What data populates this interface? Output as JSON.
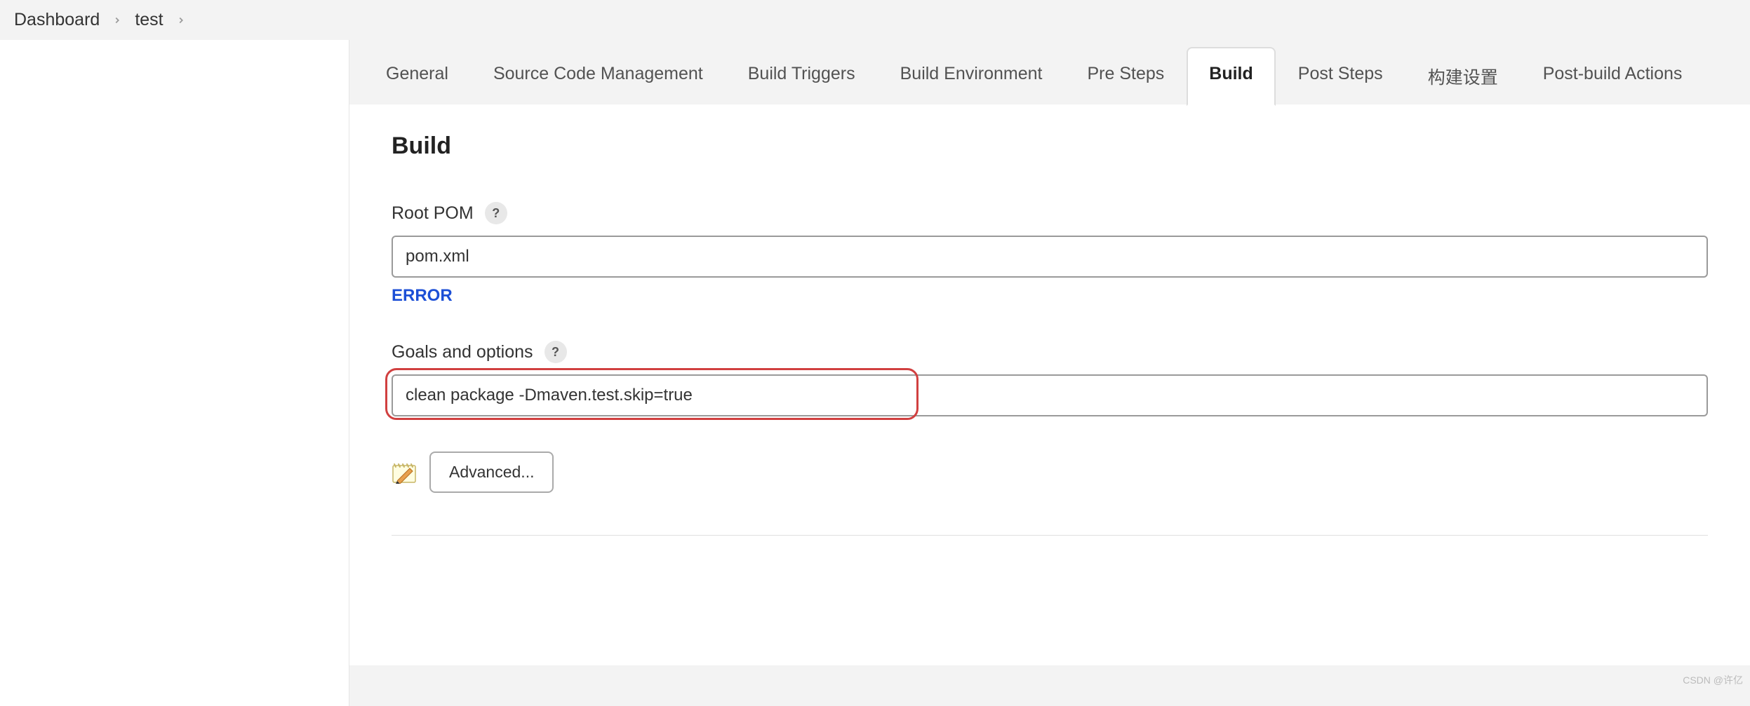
{
  "breadcrumb": {
    "items": [
      "Dashboard",
      "test"
    ]
  },
  "tabs": [
    {
      "label": "General",
      "active": false
    },
    {
      "label": "Source Code Management",
      "active": false
    },
    {
      "label": "Build Triggers",
      "active": false
    },
    {
      "label": "Build Environment",
      "active": false
    },
    {
      "label": "Pre Steps",
      "active": false
    },
    {
      "label": "Build",
      "active": true
    },
    {
      "label": "Post Steps",
      "active": false
    },
    {
      "label": "构建设置",
      "active": false
    },
    {
      "label": "Post-build Actions",
      "active": false
    }
  ],
  "section": {
    "title": "Build",
    "root_pom": {
      "label": "Root POM",
      "value": "pom.xml",
      "error": "ERROR"
    },
    "goals": {
      "label": "Goals and options",
      "value": "clean package -Dmaven.test.skip=true"
    },
    "advanced_label": "Advanced..."
  },
  "watermark": "CSDN @许亿"
}
